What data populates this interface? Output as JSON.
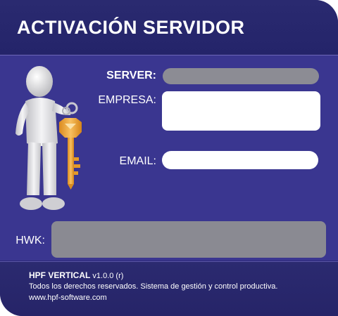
{
  "window": {
    "title": "ACTIVACIÓN SERVIDOR"
  },
  "form": {
    "server_label": "SERVER:",
    "server_value": "",
    "empresa_label": "EMPRESA:",
    "empresa_value": "",
    "email_label": "EMAIL:",
    "email_value": "",
    "hwk_label": "HWK:",
    "hwk_value": ""
  },
  "illustration": {
    "icon": "person-holding-key-icon"
  },
  "footer": {
    "product_name": "HPF VERTICAL",
    "version": "v1.0.0 (r)",
    "rights": "Todos los derechos reservados.  Sistema de gestión y control productiva.",
    "website": "www.hpf-software.com"
  },
  "colors": {
    "background": "#3a3690",
    "title_bar": "#24246a",
    "key": "#f0a83a",
    "disabled_field": "#8c8c94"
  }
}
